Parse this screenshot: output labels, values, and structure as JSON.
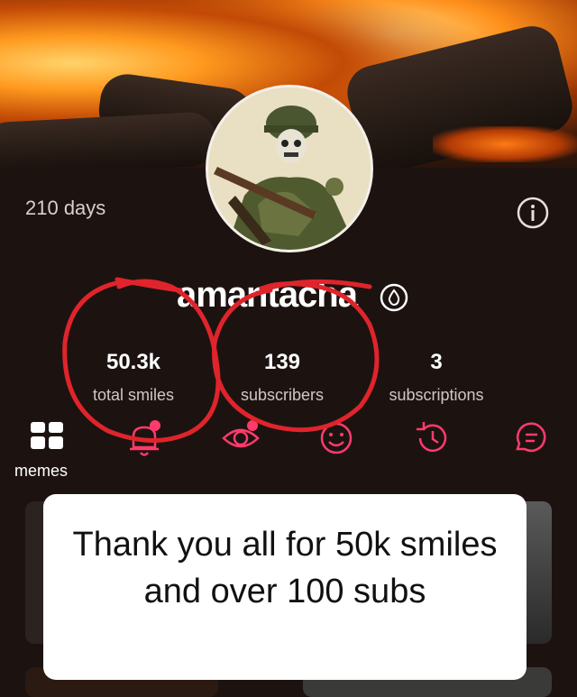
{
  "profile": {
    "days": "210 days",
    "username": "amantacha",
    "stats": [
      {
        "value": "50.3k",
        "label": "total smiles"
      },
      {
        "value": "139",
        "label": "subscribers"
      },
      {
        "value": "3",
        "label": "subscriptions"
      }
    ]
  },
  "tabs": {
    "items": [
      {
        "icon": "grid-icon",
        "label": "memes",
        "active": true
      },
      {
        "icon": "bell-icon",
        "notify": true
      },
      {
        "icon": "eye-icon",
        "notify": true
      },
      {
        "icon": "smiley-icon"
      },
      {
        "icon": "history-icon"
      },
      {
        "icon": "chat-icon"
      }
    ],
    "active_label": "memes"
  },
  "caption": {
    "text": "Thank you all for 50k smiles and over 100 subs"
  },
  "colors": {
    "annotation_red": "#e0242b",
    "notify_dot": "#ff3b6b",
    "background": "#1c1311"
  }
}
